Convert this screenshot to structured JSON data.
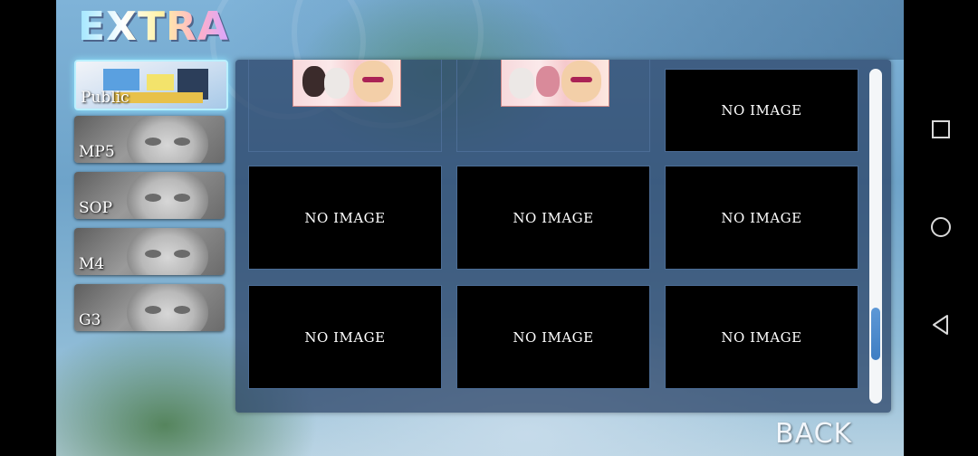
{
  "screen": {
    "title": "EXTRA",
    "back_label": "BACK"
  },
  "tabs": [
    {
      "label": "Public",
      "active": true
    },
    {
      "label": "MP5",
      "active": false
    },
    {
      "label": "SOP",
      "active": false
    },
    {
      "label": "M4",
      "active": false
    },
    {
      "label": "G3",
      "active": false
    }
  ],
  "gallery": {
    "empty_label": "NO IMAGE",
    "cells": [
      {
        "type": "image",
        "label": ""
      },
      {
        "type": "image",
        "label": ""
      },
      {
        "type": "empty",
        "label": "NO IMAGE"
      },
      {
        "type": "empty",
        "label": "NO IMAGE"
      },
      {
        "type": "empty",
        "label": "NO IMAGE"
      },
      {
        "type": "empty",
        "label": "NO IMAGE"
      },
      {
        "type": "empty",
        "label": "NO IMAGE"
      },
      {
        "type": "empty",
        "label": "NO IMAGE"
      },
      {
        "type": "empty",
        "label": "NO IMAGE"
      }
    ],
    "scroll_position": 0.85
  },
  "navbar": {
    "icons": [
      "recents-square-icon",
      "home-circle-icon",
      "back-triangle-icon"
    ]
  },
  "colors": {
    "accent": "#8fe6ff",
    "panel": "#284064",
    "scroll_thumb": "#4f8fd0"
  }
}
